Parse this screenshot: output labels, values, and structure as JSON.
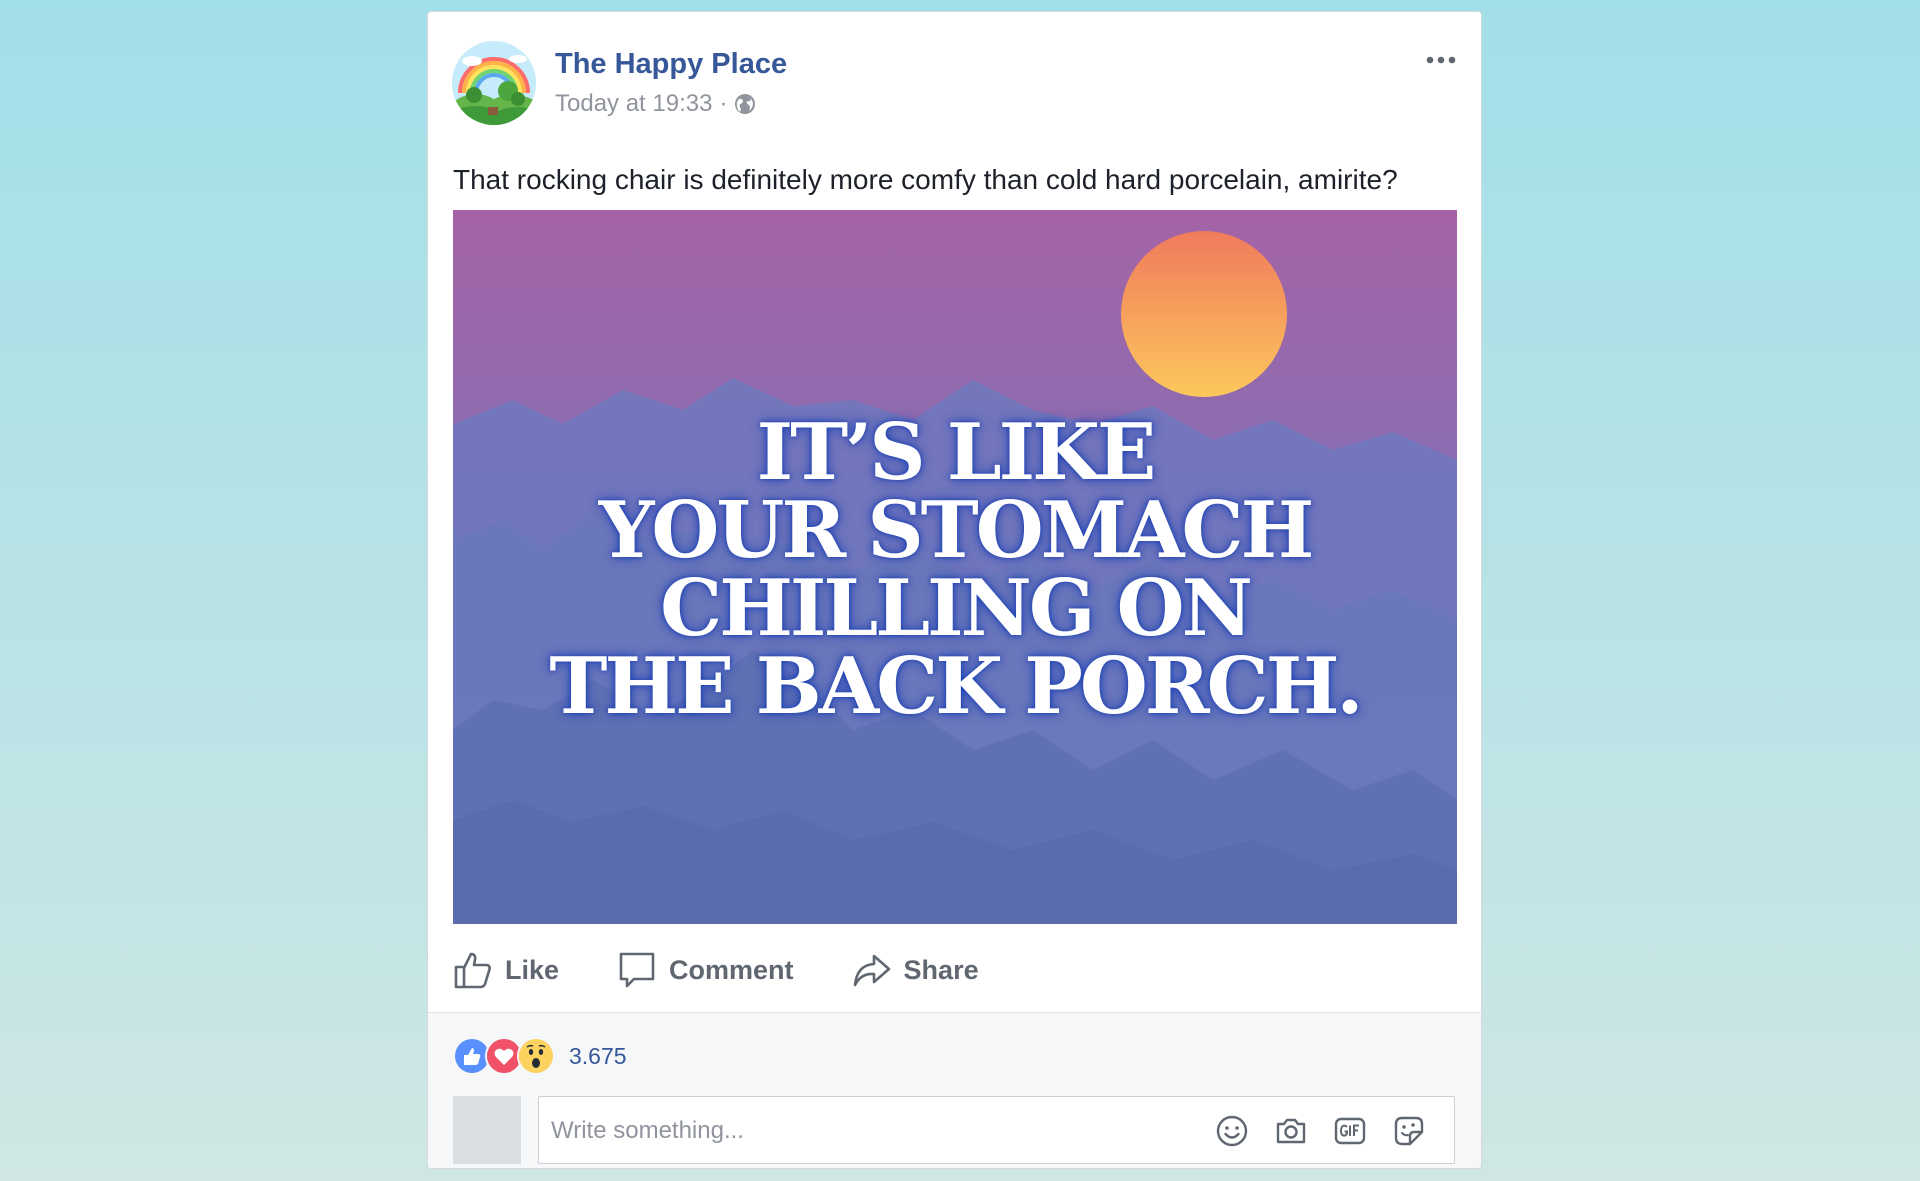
{
  "post": {
    "page_name": "The Happy Place",
    "timestamp": "Today at 19:33",
    "separator": "·",
    "privacy_icon": "globe-icon",
    "more_icon": "more-options-icon",
    "text": "That rocking chair is definitely more comfy than cold hard porcelain, amirite?",
    "image": {
      "headline_lines": [
        "IT’S LIKE",
        "YOUR STOMACH",
        "CHILLING ON",
        "THE BACK PORCH."
      ],
      "colors": {
        "sky_top": "#a563a6",
        "sky_bottom": "#5a7fc4",
        "sun_top": "#f07a5c",
        "sun_bottom": "#fdc85c",
        "mountain_far": "#6f78be",
        "mountain_near": "#5f6fb3"
      }
    }
  },
  "actions": [
    {
      "label": "Like",
      "icon": "thumbs-up-icon"
    },
    {
      "label": "Comment",
      "icon": "comment-icon"
    },
    {
      "label": "Share",
      "icon": "share-icon"
    }
  ],
  "reactions": {
    "icons": [
      "like-reaction-icon",
      "love-reaction-icon",
      "wow-reaction-icon"
    ],
    "count": "3.675"
  },
  "comment": {
    "placeholder": "Write something...",
    "tools": [
      "emoji-icon",
      "camera-icon",
      "gif-icon",
      "sticker-icon"
    ]
  },
  "colors": {
    "link_blue": "#365899",
    "muted_gray": "#90949c",
    "action_gray": "#606770",
    "like_blue": "#5890ff",
    "love_red": "#f25268",
    "wow_yellow": "#fed25e"
  }
}
